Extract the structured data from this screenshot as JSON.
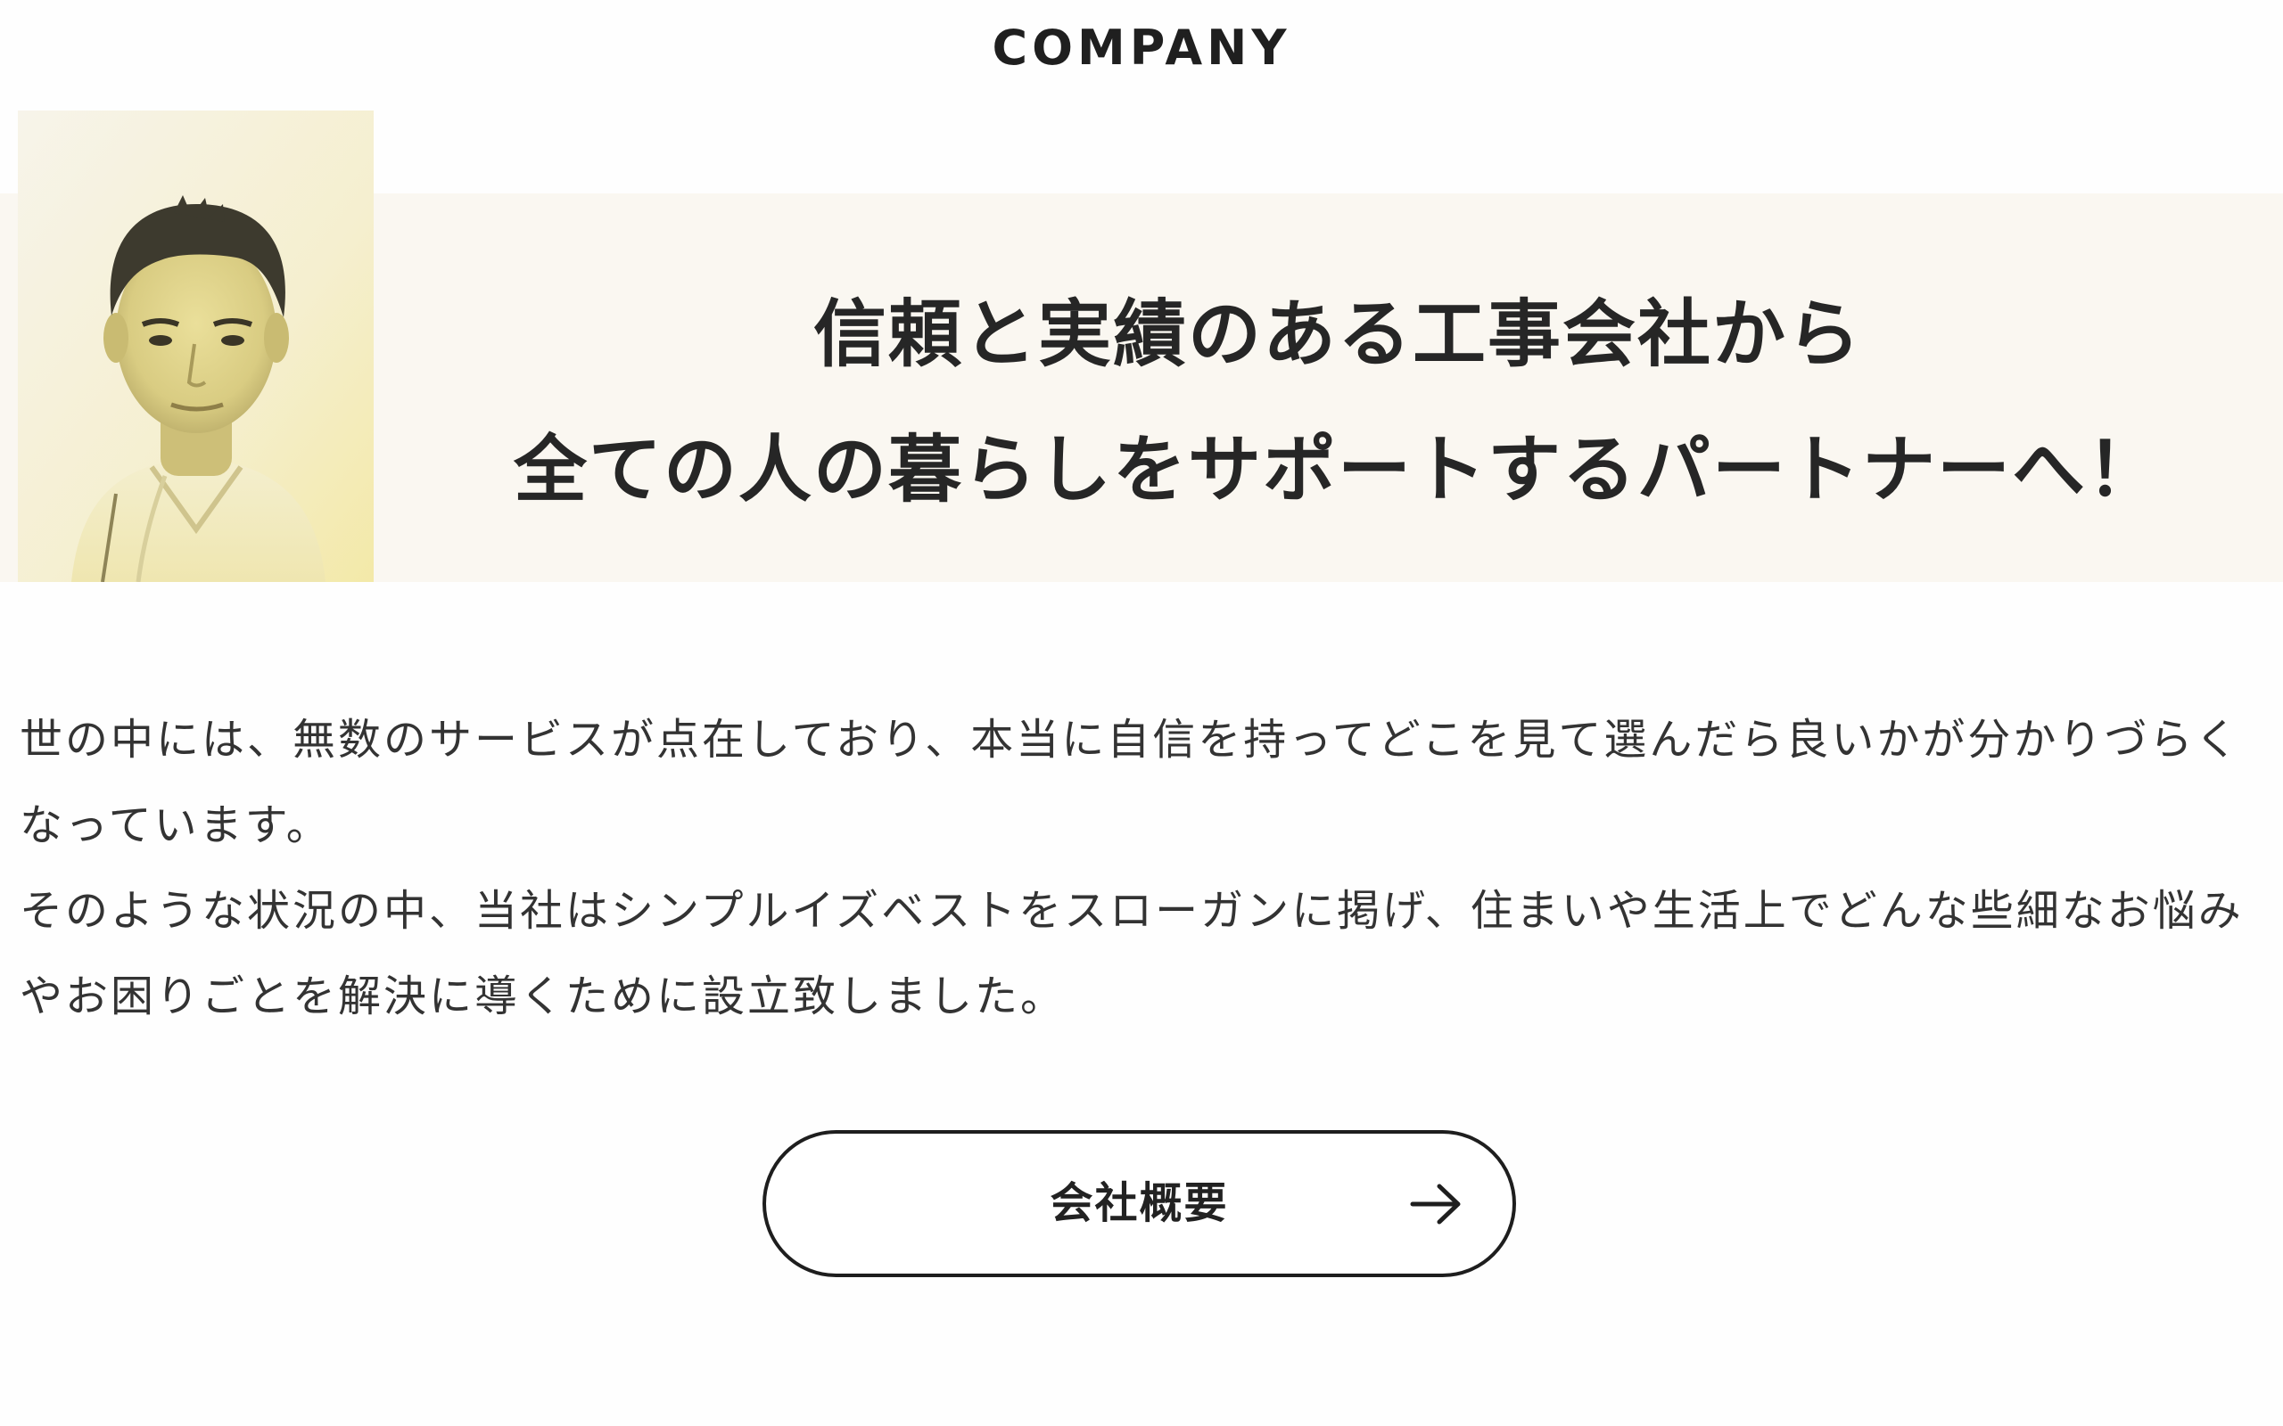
{
  "section": {
    "title": "COMPANY"
  },
  "hero": {
    "headline_line1": "信頼と実績のある工事会社から",
    "headline_line2": "全ての人の暮らしをサポートするパートナーへ！",
    "banner_color": "#faf7f1",
    "portrait_tint": "#f2e9a6"
  },
  "intro": {
    "paragraph1": "世の中には、無数のサービスが点在しており、本当に自信を持ってどこを見て選んだら良いかが分かりづらくなっています。",
    "paragraph2": "そのような状況の中、当社はシンプルイズベストをスローガンに掲げ、住まいや生活上でどんな些細なお悩みやお困りごとを解決に導くために設立致しました。"
  },
  "cta": {
    "label": "会社概要",
    "icon": "arrow-right-icon"
  }
}
